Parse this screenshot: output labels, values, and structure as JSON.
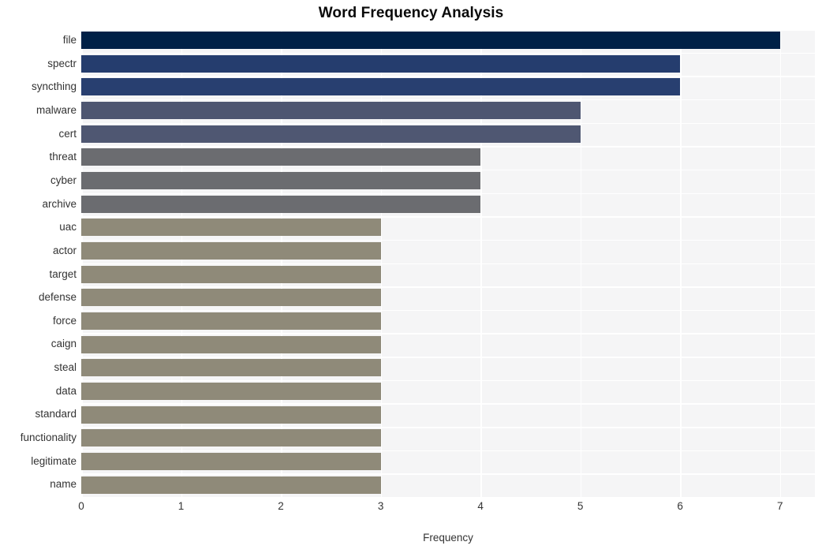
{
  "chart_data": {
    "type": "bar",
    "orientation": "horizontal",
    "title": "Word Frequency Analysis",
    "xlabel": "Frequency",
    "ylabel": "",
    "xlim": [
      0,
      7.35
    ],
    "ylim": [
      0,
      20
    ],
    "grid": true,
    "legend": null,
    "xticks": [
      "0",
      "1",
      "2",
      "3",
      "4",
      "5",
      "6",
      "7"
    ],
    "xtick_values": [
      0,
      1,
      2,
      3,
      4,
      5,
      6,
      7
    ],
    "categories": [
      "file",
      "spectr",
      "syncthing",
      "malware",
      "cert",
      "threat",
      "cyber",
      "archive",
      "uac",
      "actor",
      "target",
      "defense",
      "force",
      "caign",
      "steal",
      "data",
      "standard",
      "functionality",
      "legitimate",
      "name"
    ],
    "values": [
      7,
      6,
      6,
      5,
      5,
      4,
      4,
      4,
      3,
      3,
      3,
      3,
      3,
      3,
      3,
      3,
      3,
      3,
      3,
      3
    ],
    "bar_colors": [
      "#002147",
      "#253d6e",
      "#283f70",
      "#4e5671",
      "#4f5772",
      "#6b6c70",
      "#6b6c70",
      "#6b6c70",
      "#8f8a79",
      "#8f8a79",
      "#8f8a79",
      "#8f8a79",
      "#8f8a79",
      "#8f8a79",
      "#8f8a79",
      "#8f8a79",
      "#8f8a79",
      "#8f8a79",
      "#8f8a79",
      "#8f8a79"
    ]
  },
  "style": {
    "figure_background": "#ffffff",
    "plot_background": "#f5f5f6",
    "gridline_color": "#ffffff",
    "title_color": "#0a0a0a",
    "tick_label_color": "#333333"
  }
}
